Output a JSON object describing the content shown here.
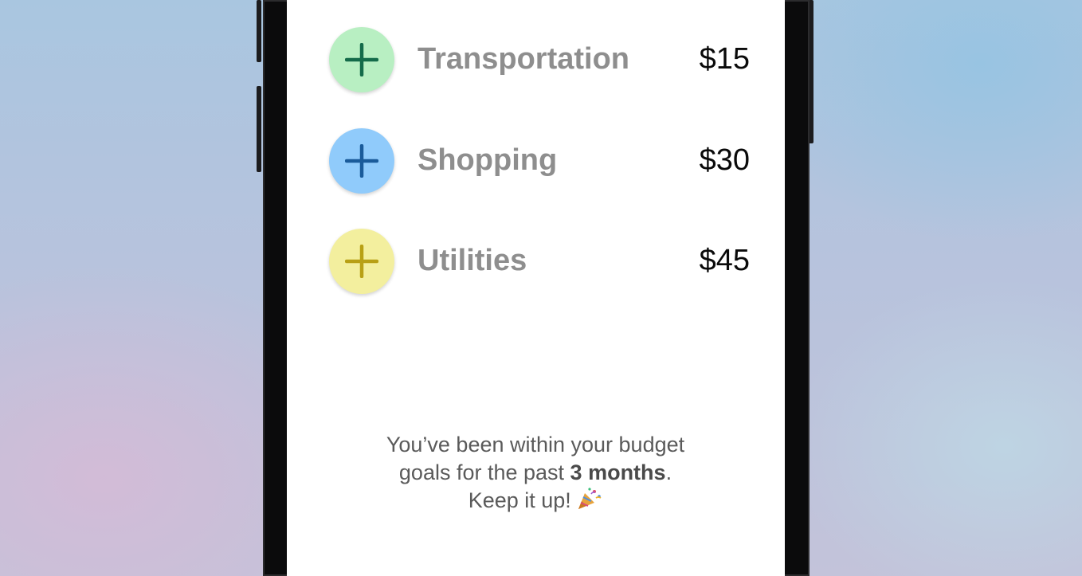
{
  "categories": [
    {
      "label": "Transportation",
      "amount": "$15",
      "icon": "plus-icon",
      "bg_color": "#b8efc2",
      "icon_color": "#146b4a"
    },
    {
      "label": "Shopping",
      "amount": "$30",
      "icon": "plus-icon",
      "bg_color": "#90cbfb",
      "icon_color": "#1a5b9a"
    },
    {
      "label": "Utilities",
      "amount": "$45",
      "icon": "plus-icon",
      "bg_color": "#f3ef9e",
      "icon_color": "#b8a015"
    }
  ],
  "message": {
    "line1": "You’ve been within your budget",
    "line2_prefix": "goals for the past ",
    "line2_bold": "3 months",
    "line2_suffix": ".",
    "line3": "Keep it up!",
    "emoji_icon": "party-popper-icon"
  }
}
